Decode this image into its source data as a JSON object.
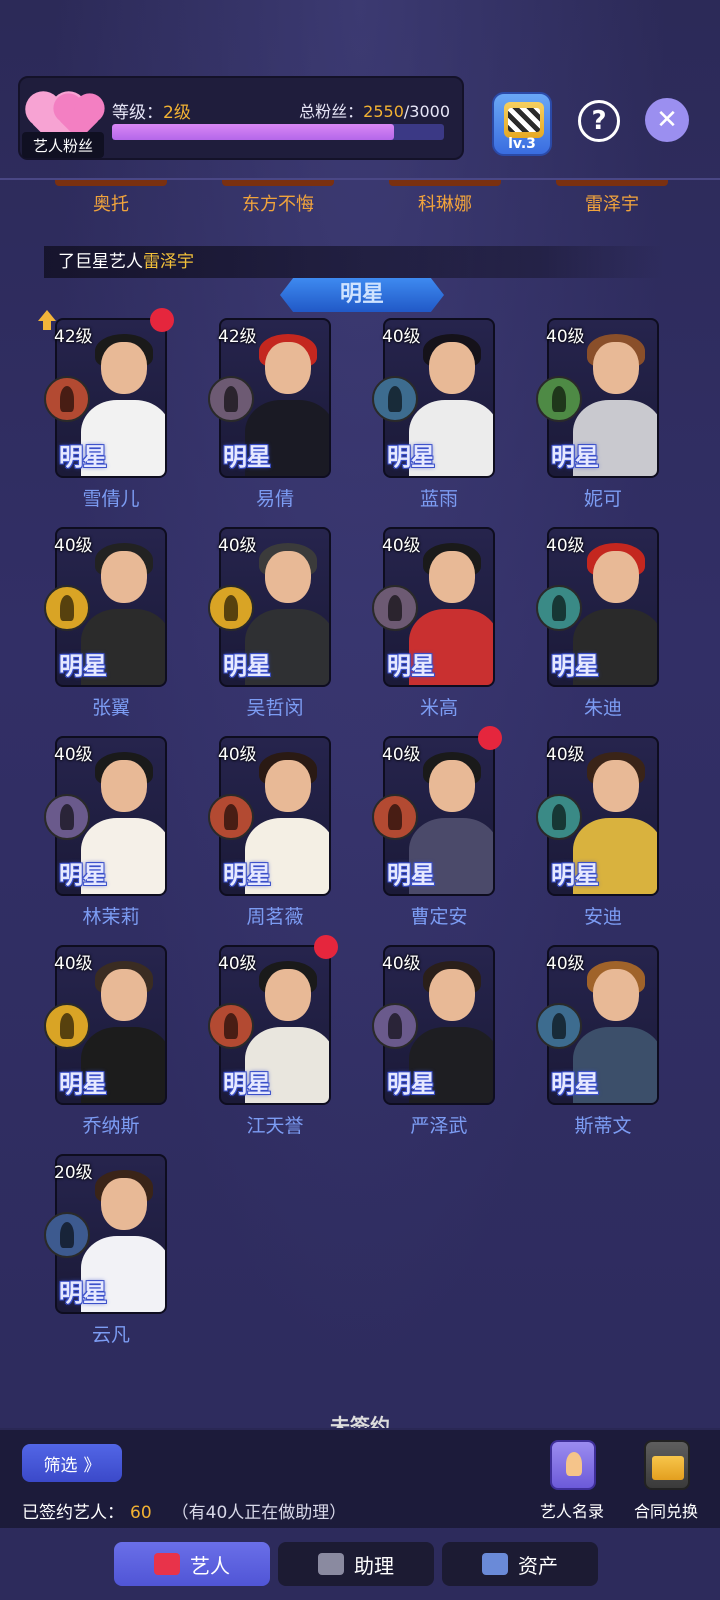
{
  "header": {
    "badge_label": "艺人粉丝",
    "level_prefix": "等级：",
    "level_value": "2级",
    "fans_prefix": "总粉丝：",
    "fans_current": "2550",
    "fans_sep_total": "/3000",
    "fans_progress": 0.85,
    "studio_level": "lv.3",
    "help_symbol": "?",
    "close_symbol": "✕"
  },
  "top_names": [
    "奥托",
    "东方不悔",
    "科琳娜",
    "雷泽宇"
  ],
  "marquee": {
    "prefix": "了巨星艺人",
    "highlight": "雷泽宇"
  },
  "section_title": "明星",
  "star_badge": "明星",
  "artists": [
    {
      "name": "雪倩儿",
      "level": "42级",
      "red_dot": true,
      "upgrade": true,
      "role_color": "#b34a32",
      "hair": "#1a1a1a",
      "body": "#f2f2f2"
    },
    {
      "name": "易倩",
      "level": "42级",
      "red_dot": false,
      "upgrade": false,
      "role_color": "#6d5a73",
      "hair": "#c4271f",
      "body": "#1a1a24"
    },
    {
      "name": "蓝雨",
      "level": "40级",
      "red_dot": false,
      "upgrade": false,
      "role_color": "#3d6c8f",
      "hair": "#15121a",
      "body": "#ececec"
    },
    {
      "name": "妮可",
      "level": "40级",
      "red_dot": false,
      "upgrade": false,
      "role_color": "#4e8a45",
      "hair": "#8a4f2a",
      "body": "#c9c9cf"
    },
    {
      "name": "张翼",
      "level": "40级",
      "red_dot": false,
      "upgrade": false,
      "role_color": "#d9a425",
      "hair": "#222",
      "body": "#2b2b2b"
    },
    {
      "name": "吴哲闵",
      "level": "40级",
      "red_dot": false,
      "upgrade": false,
      "role_color": "#d9a425",
      "hair": "#3b3b3b",
      "body": "#2f3033"
    },
    {
      "name": "米高",
      "level": "40级",
      "red_dot": false,
      "upgrade": false,
      "role_color": "#6d5a73",
      "hair": "#1a1a1a",
      "body": "#c93030"
    },
    {
      "name": "朱迪",
      "level": "40级",
      "red_dot": false,
      "upgrade": false,
      "role_color": "#3a8a86",
      "hair": "#c4271f",
      "body": "#2a2a2a"
    },
    {
      "name": "林茉莉",
      "level": "40级",
      "red_dot": false,
      "upgrade": false,
      "role_color": "#6a5a8c",
      "hair": "#1a1a1a",
      "body": "#f5f0e8"
    },
    {
      "name": "周茗薇",
      "level": "40级",
      "red_dot": false,
      "upgrade": false,
      "role_color": "#b34a32",
      "hair": "#2a1a14",
      "body": "#f4efe4"
    },
    {
      "name": "曹定安",
      "level": "40级",
      "red_dot": true,
      "upgrade": false,
      "role_color": "#b34a32",
      "hair": "#1a1a1a",
      "body": "#4b4a6a"
    },
    {
      "name": "安迪",
      "level": "40级",
      "red_dot": false,
      "upgrade": false,
      "role_color": "#3a8a86",
      "hair": "#3a2418",
      "body": "#d9b23e"
    },
    {
      "name": "乔纳斯",
      "level": "40级",
      "red_dot": false,
      "upgrade": false,
      "role_color": "#d9a425",
      "hair": "#3a2c22",
      "body": "#1c1c1c"
    },
    {
      "name": "江天誉",
      "level": "40级",
      "red_dot": true,
      "upgrade": false,
      "role_color": "#b34a32",
      "hair": "#1a1a1a",
      "body": "#e9e6de"
    },
    {
      "name": "严泽武",
      "level": "40级",
      "red_dot": false,
      "upgrade": false,
      "role_color": "#6a5a8c",
      "hair": "#2a1f1a",
      "body": "#1e1e22"
    },
    {
      "name": "斯蒂文",
      "level": "40级",
      "red_dot": false,
      "upgrade": false,
      "role_color": "#3d6c8f",
      "hair": "#a0632a",
      "body": "#3c4f6a"
    },
    {
      "name": "云凡",
      "level": "20级",
      "red_dot": false,
      "upgrade": false,
      "role_color": "#3d5a8f",
      "hair": "#3a2418",
      "body": "#f2f2f6"
    }
  ],
  "unsigned_title": "未签约",
  "bottom": {
    "filter_label": "筛选",
    "filter_arrow": "》",
    "signed_label": "已签约艺人：",
    "signed_count": "60",
    "signed_note": "（有40人正在做助理）",
    "directory_label": "艺人名录",
    "contract_label": "合同兑换"
  },
  "tabs": [
    {
      "label": "艺人",
      "active": true,
      "icon": "lips-icon",
      "icon_color": "#e8334a"
    },
    {
      "label": "助理",
      "active": false,
      "icon": "assistant-icon",
      "icon_color": "#8a8aa0"
    },
    {
      "label": "资产",
      "active": false,
      "icon": "assets-icon",
      "icon_color": "#6a8ad8"
    }
  ]
}
